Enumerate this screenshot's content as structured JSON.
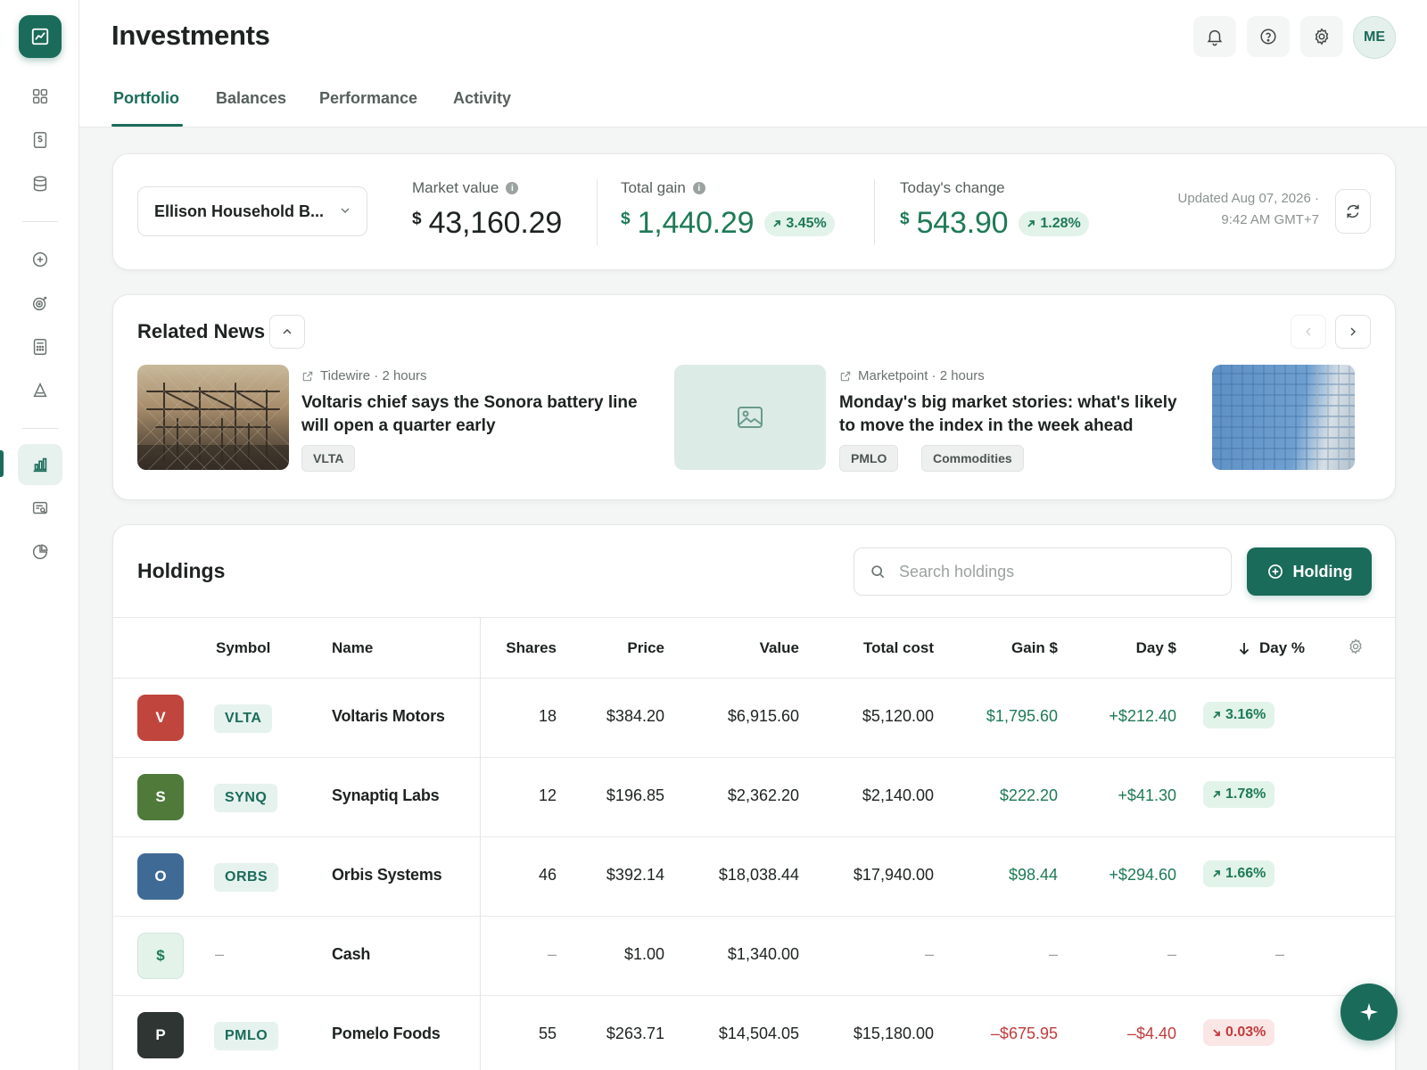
{
  "page": {
    "title": "Investments"
  },
  "sidebar": {
    "items": [
      {
        "icon": "dashboard-grid-icon"
      },
      {
        "icon": "dollar-doc-icon"
      },
      {
        "icon": "database-icon"
      },
      {
        "icon": "add-circle-icon"
      },
      {
        "icon": "target-icon"
      },
      {
        "icon": "calculator-icon"
      },
      {
        "icon": "triangle-icon"
      },
      {
        "icon": "bar-chart-icon",
        "active": true
      },
      {
        "icon": "report-search-icon"
      },
      {
        "icon": "pie-chart-icon"
      }
    ]
  },
  "header": {
    "avatar_initials": "ME",
    "tabs": [
      {
        "label": "Portfolio",
        "active": true
      },
      {
        "label": "Balances"
      },
      {
        "label": "Performance"
      },
      {
        "label": "Activity"
      }
    ]
  },
  "summary": {
    "account": "Ellison Household B...",
    "market_value": {
      "label": "Market value",
      "currency": "$",
      "value": "43,160.29"
    },
    "total_gain": {
      "label": "Total gain",
      "currency": "$",
      "value": "1,440.29",
      "percent": "3.45%"
    },
    "todays_change": {
      "label": "Today's change",
      "currency": "$",
      "value": "543.90",
      "percent": "1.28%"
    },
    "updated_line1": "Updated Aug 07, 2026 ·",
    "updated_line2": "9:42 AM GMT+7"
  },
  "news": {
    "title": "Related News",
    "items": [
      {
        "source": "Tidewire · 2 hours",
        "headline": "Voltaris chief says the Sonora battery line will open a quarter early",
        "tags": [
          "VLTA"
        ]
      },
      {
        "source": "Marketpoint · 2 hours",
        "headline": "Monday's big market stories: what's likely to move the index in the week ahead",
        "tags": [
          "PMLO",
          "Commodities"
        ]
      }
    ]
  },
  "holdings": {
    "title": "Holdings",
    "search_placeholder": "Search holdings",
    "add_label": "Holding",
    "columns": {
      "symbol": "Symbol",
      "name": "Name",
      "shares": "Shares",
      "price": "Price",
      "value": "Value",
      "total_cost": "Total cost",
      "gain": "Gain $",
      "day": "Day $",
      "day_pct": "Day %"
    },
    "rows": [
      {
        "initial": "V",
        "color": "#c0453d",
        "symbol": "VLTA",
        "name": "Voltaris Motors",
        "shares": "18",
        "price": "$384.20",
        "value": "$6,915.60",
        "total_cost": "$5,120.00",
        "gain": "$1,795.60",
        "day": "+$212.40",
        "day_pct": "3.16%",
        "trend": "up"
      },
      {
        "initial": "S",
        "color": "#4f7a3a",
        "symbol": "SYNQ",
        "name": "Synaptiq Labs",
        "shares": "12",
        "price": "$196.85",
        "value": "$2,362.20",
        "total_cost": "$2,140.00",
        "gain": "$222.20",
        "day": "+$41.30",
        "day_pct": "1.78%",
        "trend": "up"
      },
      {
        "initial": "O",
        "color": "#3f6a96",
        "symbol": "ORBS",
        "name": "Orbis Systems",
        "shares": "46",
        "price": "$392.14",
        "value": "$18,038.44",
        "total_cost": "$17,940.00",
        "gain": "$98.44",
        "day": "+$294.60",
        "day_pct": "1.66%",
        "trend": "up"
      },
      {
        "initial": "$",
        "color": "#e4f3ea",
        "symbol": "–",
        "name": "Cash",
        "shares": "–",
        "price": "$1.00",
        "value": "$1,340.00",
        "total_cost": "–",
        "gain": "–",
        "day": "–",
        "day_pct": "–",
        "trend": "none"
      },
      {
        "initial": "P",
        "color": "#2f3533",
        "symbol": "PMLO",
        "name": "Pomelo Foods",
        "shares": "55",
        "price": "$263.71",
        "value": "$14,504.05",
        "total_cost": "$15,180.00",
        "gain": "–$675.95",
        "day": "–$4.40",
        "day_pct": "0.03%",
        "trend": "down"
      }
    ]
  }
}
